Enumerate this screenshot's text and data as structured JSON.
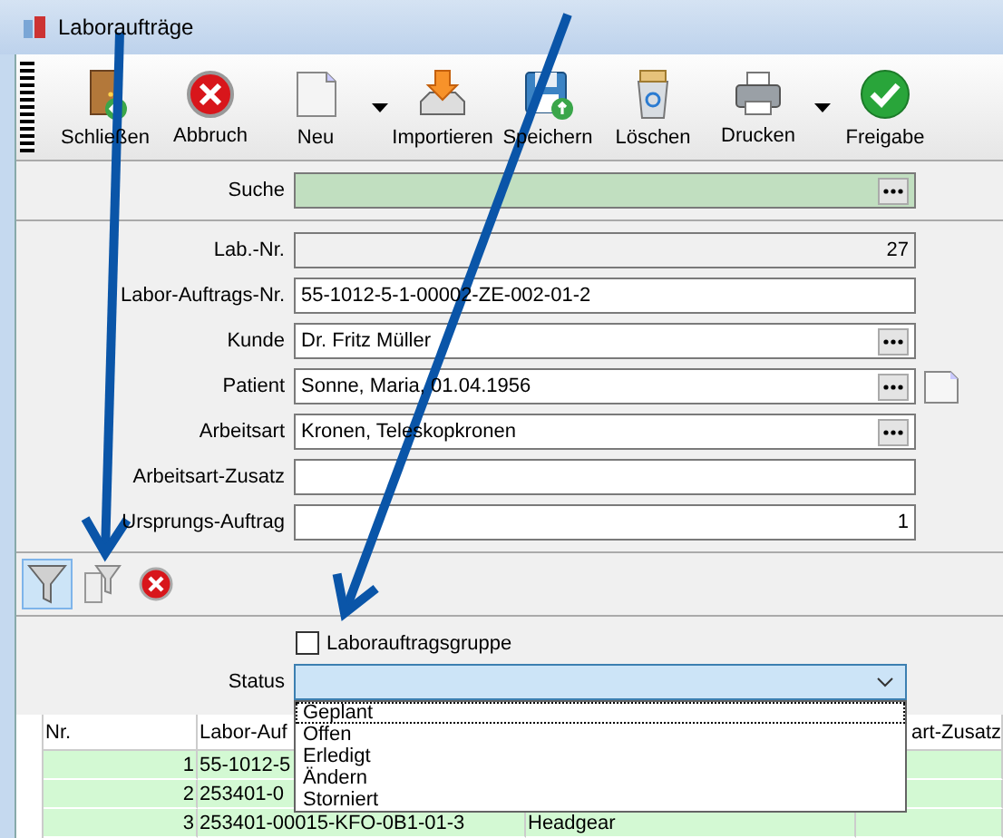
{
  "window": {
    "title": "Laboraufträge"
  },
  "toolbar": [
    {
      "label": "Schließen",
      "has_menu": false
    },
    {
      "label": "Abbruch",
      "has_menu": false
    },
    {
      "label": "Neu",
      "has_menu": true
    },
    {
      "label": "Importieren",
      "has_menu": false
    },
    {
      "label": "Speichern",
      "has_menu": false
    },
    {
      "label": "Löschen",
      "has_menu": false
    },
    {
      "label": "Drucken",
      "has_menu": true
    },
    {
      "label": "Freigabe",
      "has_menu": false
    }
  ],
  "search": {
    "label": "Suche",
    "highlighted": true
  },
  "fields": [
    {
      "label": "Lab.-Nr.",
      "value": "27",
      "kind": "number",
      "readonly": true,
      "lookup": false,
      "note": false
    },
    {
      "label": "Labor-Auftrags-Nr.",
      "value": "55-1012-5-1-00002-ZE-002-01-2",
      "kind": "text",
      "readonly": false,
      "lookup": false,
      "note": false
    },
    {
      "label": "Kunde",
      "value": "Dr. Fritz Müller",
      "kind": "text",
      "readonly": false,
      "lookup": true,
      "note": false
    },
    {
      "label": "Patient",
      "value": "Sonne, Maria, 01.04.1956",
      "kind": "text",
      "readonly": false,
      "lookup": true,
      "note": true
    },
    {
      "label": "Arbeitsart",
      "value": "Kronen, Teleskopkronen",
      "kind": "text",
      "readonly": false,
      "lookup": true,
      "note": false
    },
    {
      "label": "Arbeitsart-Zusatz",
      "kind": "text",
      "readonly": false,
      "lookup": false,
      "note": false
    },
    {
      "label": "Ursprungs-Auftrag",
      "value": "1",
      "kind": "number",
      "readonly": false,
      "lookup": false,
      "note": false
    }
  ],
  "filter_tools": [
    {
      "selected": true
    },
    {
      "selected": false
    },
    {
      "selected": false
    }
  ],
  "group_checkbox": {
    "label": "Laborauftragsgruppe",
    "checked": false
  },
  "status": {
    "label": "Status",
    "open": true,
    "options": [
      {
        "label": "Geplant",
        "selected": true
      },
      {
        "label": "Offen",
        "selected": false
      },
      {
        "label": "Erledigt",
        "selected": false
      },
      {
        "label": "Ändern",
        "selected": false
      },
      {
        "label": "Storniert",
        "selected": false
      }
    ]
  },
  "table": {
    "columns": [
      "Nr.",
      "Labor-Auf",
      null,
      "art-Zusatz"
    ],
    "rows": [
      [
        "1",
        "55-1012-5",
        null,
        null
      ],
      [
        "2",
        "253401-0",
        null,
        null
      ],
      [
        "3",
        "253401-00015-KFO-0B1-01-3",
        "Headgear",
        null
      ]
    ]
  }
}
